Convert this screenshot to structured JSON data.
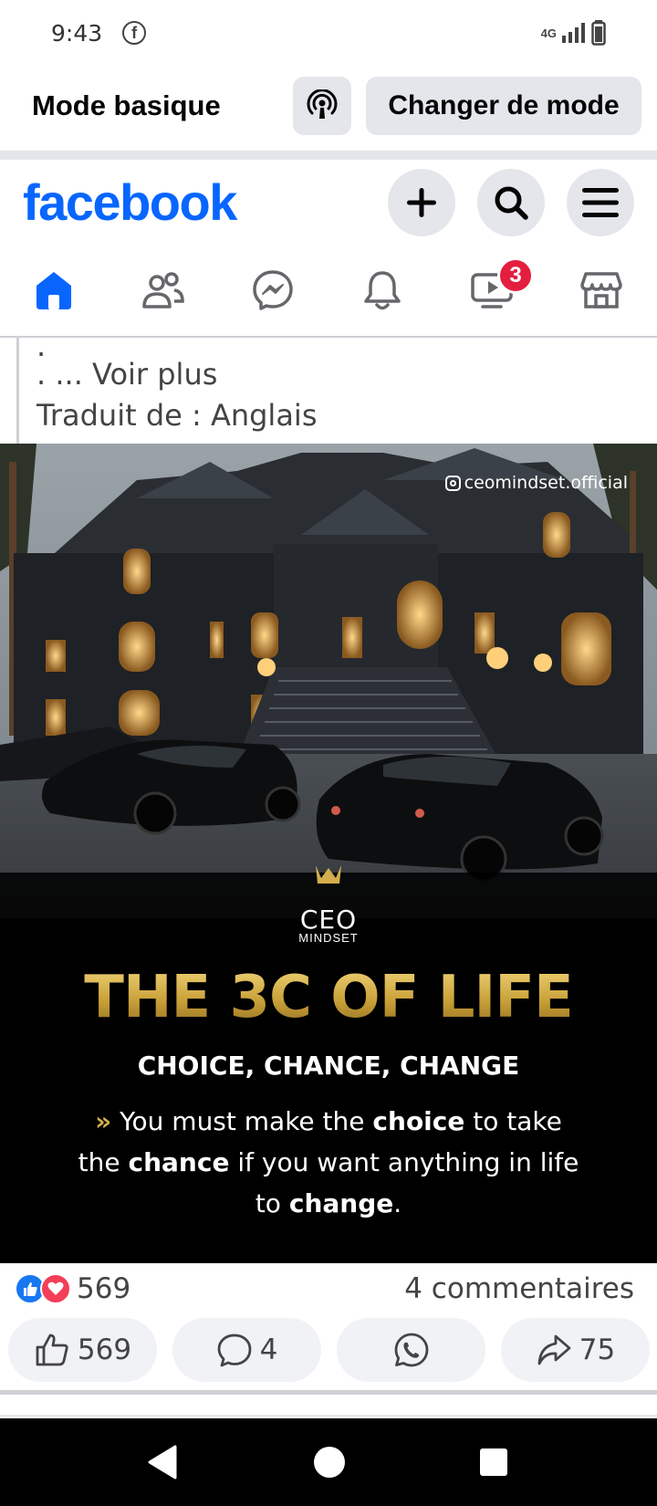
{
  "status_bar": {
    "time": "9:43",
    "left_icon": "facebook-notification-icon",
    "network": "4G"
  },
  "mode_bar": {
    "title": "Mode basique",
    "podcast_icon": "podcast-icon",
    "change_mode_label": "Changer de mode"
  },
  "header": {
    "logo": "facebook",
    "brand_color": "#0866ff",
    "buttons": [
      "plus-icon",
      "search-icon",
      "menu-icon"
    ]
  },
  "nav": {
    "items": [
      {
        "name": "home",
        "icon": "home-icon",
        "active": true
      },
      {
        "name": "friends",
        "icon": "friends-icon"
      },
      {
        "name": "messenger",
        "icon": "messenger-icon"
      },
      {
        "name": "notifications",
        "icon": "bell-icon"
      },
      {
        "name": "video",
        "icon": "video-icon",
        "badge": "3"
      },
      {
        "name": "marketplace",
        "icon": "marketplace-icon"
      }
    ]
  },
  "post": {
    "text_dot": ".",
    "text_line": ". ... Voir plus",
    "translated": "Traduit de : Anglais",
    "image": {
      "watermark": "ceomindset.official",
      "logo_top": "CEO",
      "logo_bottom": "MINDSET",
      "headline": "THE 3C OF LIFE",
      "subhead": "CHOICE, CHANCE, CHANGE",
      "quote_prefix": "»",
      "quote_part1": "You must make the ",
      "quote_b1": "choice",
      "quote_part2": " to take the ",
      "quote_b2": "chance",
      "quote_part3": " if you want anything in life to ",
      "quote_b3": "change",
      "quote_end": "."
    },
    "reactions": {
      "count": "569",
      "comments": "4 commentaires"
    },
    "actions": {
      "like_count": "569",
      "comment_count": "4",
      "share_count": "75"
    }
  },
  "colors": {
    "like_blue": "#1877f2",
    "love_red": "#f33e58",
    "badge_red": "#e41e3f",
    "gold": "#c9a43f"
  }
}
